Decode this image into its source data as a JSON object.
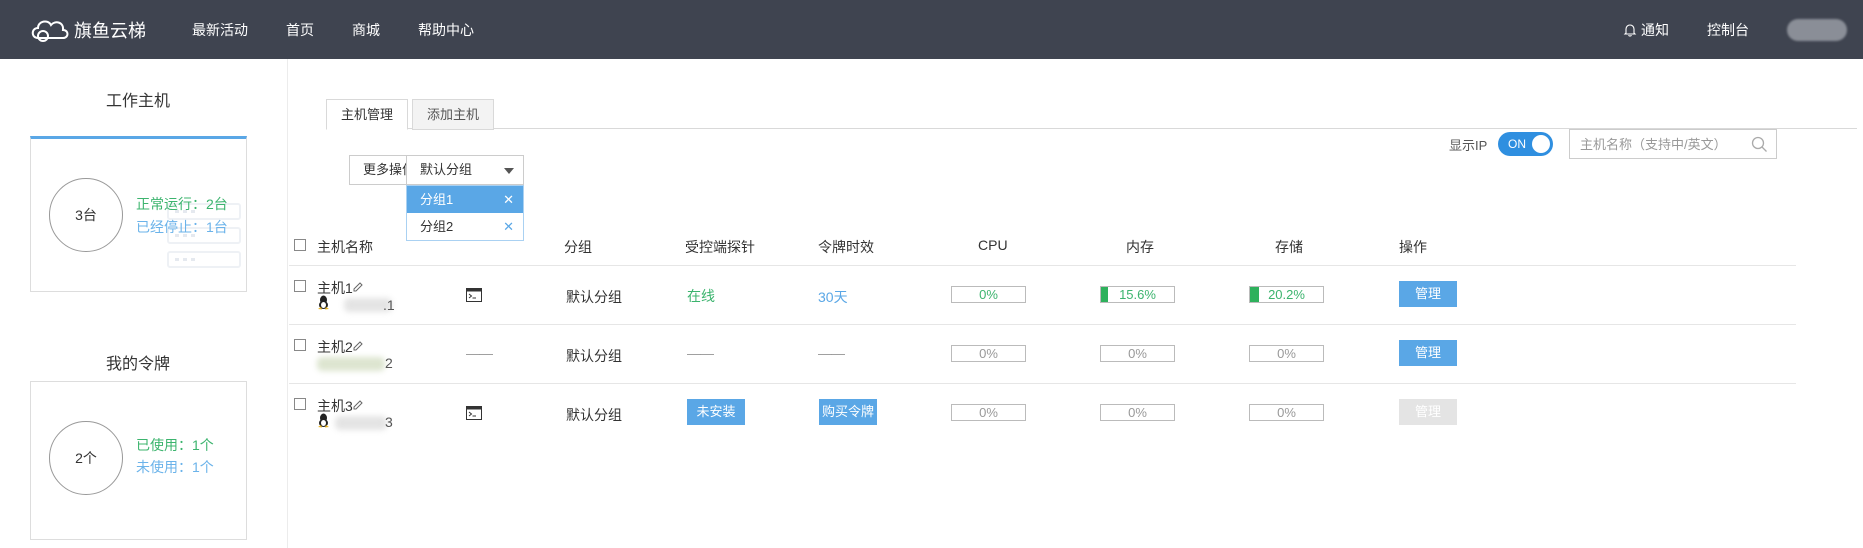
{
  "brand": {
    "name": "旗鱼云梯"
  },
  "nav": {
    "items": [
      "最新活动",
      "首页",
      "商城",
      "帮助中心"
    ]
  },
  "topbar": {
    "notify_label": "通知",
    "console_label": "控制台"
  },
  "left": {
    "hosts": {
      "title": "工作主机",
      "count": "3台",
      "running": "正常运行：2台",
      "stopped": "已经停止：1台"
    },
    "tokens": {
      "title": "我的令牌",
      "count": "2个",
      "used": "已使用：1个",
      "unused": "未使用：1个"
    }
  },
  "tabs": [
    "主机管理",
    "添加主机"
  ],
  "toolbar": {
    "more_actions": "更多操作",
    "group_select": "默认分组",
    "group_options": [
      "分组1",
      "分组2"
    ],
    "show_ip_label": "显示IP",
    "toggle_label": "ON",
    "search_placeholder": "主机名称（支持中/英文）"
  },
  "table": {
    "columns": [
      "主机名称",
      "分组",
      "受控端探针",
      "令牌时效",
      "CPU",
      "内存",
      "存储",
      "操作"
    ],
    "rows": [
      {
        "name": "主机1",
        "ip_suffix": ".1",
        "group": "默认分组",
        "probe": "在线",
        "token": "30天",
        "cpu": "0%",
        "mem": "15.6%",
        "disk": "20.2%",
        "mem_level": 0.156,
        "disk_level": 0.202,
        "action": "管理"
      },
      {
        "name": "主机2",
        "ip_suffix": "2",
        "group": "默认分组",
        "probe": "——",
        "token": "——",
        "terminal": "——",
        "cpu": "0%",
        "mem": "0%",
        "disk": "0%",
        "action": "管理"
      },
      {
        "name": "主机3",
        "ip_suffix": "3",
        "group": "默认分组",
        "probe": "未安装",
        "token": "购买令牌",
        "cpu": "0%",
        "mem": "0%",
        "disk": "0%",
        "action": "管理"
      }
    ]
  },
  "colors": {
    "topbar": "#3f4450",
    "accent": "#5aa7e6",
    "success": "#3cb46e",
    "toggle": "#2f8fe0"
  }
}
